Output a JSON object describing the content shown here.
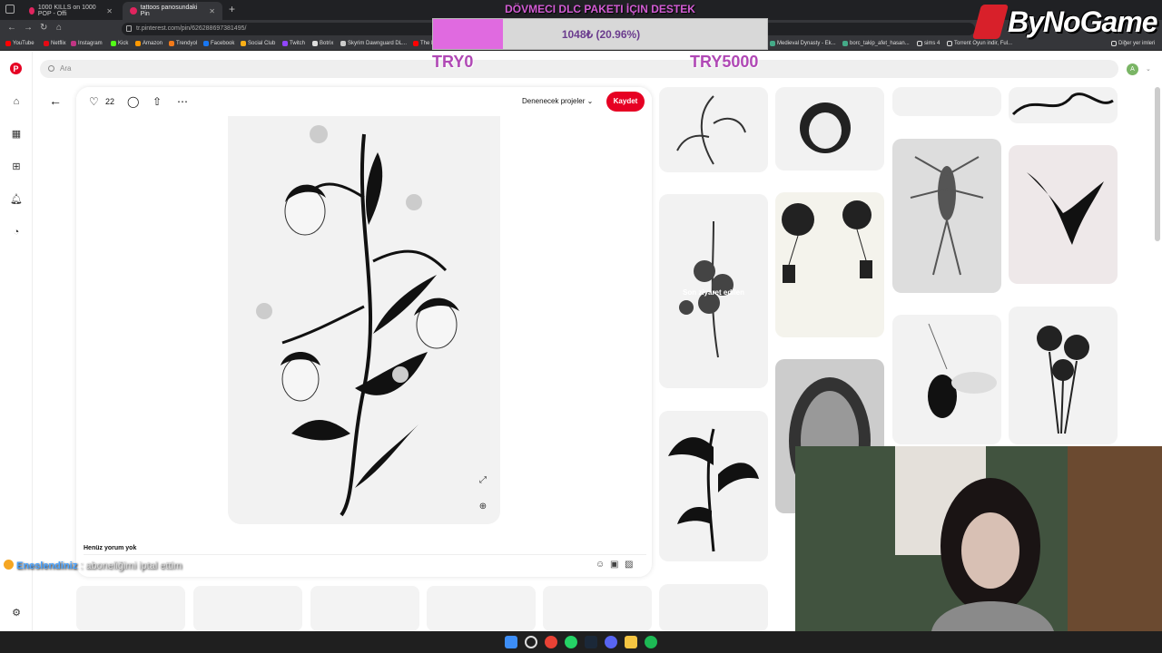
{
  "browser": {
    "tabs": [
      {
        "title": "1000 KILLS on 1000 POP - Offi",
        "active": false
      },
      {
        "title": "tattoos panosundaki Pin",
        "active": true
      }
    ],
    "url": "tr.pinterest.com/pin/626288697381495/",
    "bookmarks": [
      "YouTube",
      "Netflix",
      "Instagram",
      "Kick",
      "Amazon",
      "Trendyol",
      "Facebook",
      "Social Club",
      "Twitch",
      "Botrix",
      "Skyrim Dawnguard DL...",
      "The E",
      "Medieval Dynasty - Ek...",
      "borc_takip_afet_hasan...",
      "sims 4",
      "Torrent Oyun indir, Ful...",
      "Diğer yer imleri"
    ]
  },
  "pinterest": {
    "search_placeholder": "Ara",
    "avatar_letter": "A",
    "pin": {
      "like_count": "22",
      "board_select": "Denenecek projeler",
      "save_label": "Kaydet",
      "no_comments": "Henüz yorum yok"
    },
    "recent_label": "Son ziyaret edilen"
  },
  "stream_overlay": {
    "donation_title": "DÖVMECI DLC PAKETI İÇIN DESTEK",
    "donation_progress_text": "1048₺ (20.96%)",
    "donation_progress_fraction": 0.2096,
    "min_label": "TRY0",
    "max_label": "TRY5000",
    "brand": "ByNoGame",
    "chat_user": "Eneslendiniz",
    "chat_message": ": aboneliğimi iptal ettim"
  },
  "colors": {
    "pinterest_red": "#e60023",
    "donation_fill": "#e06ae0",
    "donation_text": "#d35cd4"
  }
}
